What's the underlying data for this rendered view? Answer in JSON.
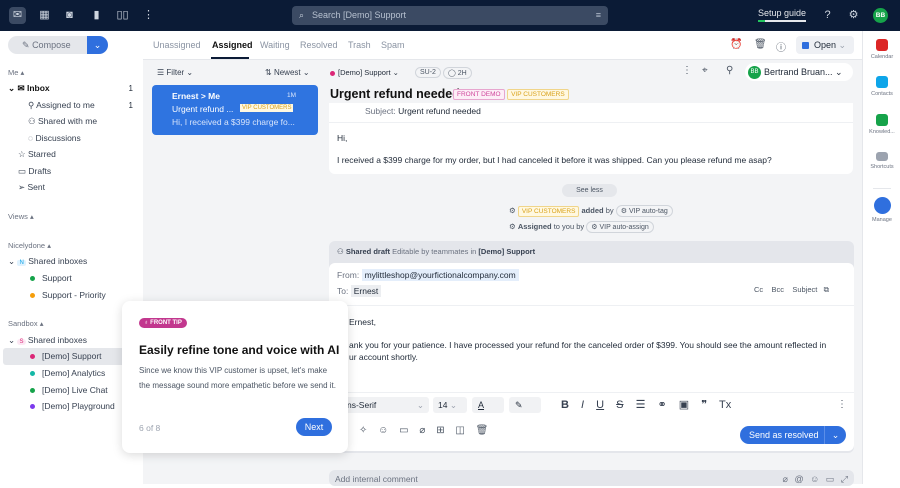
{
  "topbar": {
    "search_placeholder": "Search [Demo] Support",
    "setup_guide": "Setup guide",
    "avatar": "BB",
    "setup_progress": 0.15
  },
  "sidebar": {
    "compose": "Compose",
    "me": "Me",
    "inbox": "Inbox",
    "inbox_count": "1",
    "assigned_to_me": "Assigned to me",
    "assigned_count": "1",
    "shared_with_me": "Shared with me",
    "discussions": "Discussions",
    "starred": "Starred",
    "drafts": "Drafts",
    "sent": "Sent",
    "views": "Views",
    "nicelydone": "Nicelydone",
    "shared_inboxes_n": "Shared inboxes",
    "n_badge": "N",
    "support": "Support",
    "support_priority": "Support - Priority",
    "sandbox": "Sandbox",
    "shared_inboxes_s": "Shared inboxes",
    "s_badge": "S",
    "demo_support": "[Demo] Support",
    "demo_analytics": "[Demo] Analytics",
    "demo_live_chat": "[Demo] Live Chat",
    "demo_playground": "[Demo] Playground"
  },
  "tabs": [
    "Unassigned",
    "Assigned",
    "Waiting",
    "Resolved",
    "Trash",
    "Spam"
  ],
  "toolbar": {
    "status": "Open",
    "filter": "Filter",
    "sort": "Newest",
    "inbox": "[Demo] Support",
    "id": "SU-2",
    "time": "2H",
    "assignee": "Bertrand Bruan...",
    "assignee_avatar": "BB"
  },
  "list": [
    {
      "from": "Ernest > Me",
      "time": "1M",
      "subject": "Urgent refund ...",
      "tag": "VIP CUSTOMERS",
      "preview": "Hi, I received a $399 charge fo..."
    }
  ],
  "conversation": {
    "title": "Urgent refund needed",
    "tags": [
      "FRONT DEMO",
      "VIP CUSTOMERS"
    ],
    "subject_label": "Subject:",
    "subject": "Urgent refund needed",
    "greeting": "Hi,",
    "body": "I received a $399 charge for my order, but I had canceled it before it was shipped. Can you please refund me asap?",
    "see_less": "See less",
    "activity1": {
      "tag": "VIP CUSTOMERS",
      "added": "added",
      "by": "by",
      "rule": "VIP auto-tag"
    },
    "activity2": {
      "assigned": "Assigned",
      "to_you_by": "to you by",
      "rule": "VIP auto-assign"
    }
  },
  "draft": {
    "header": "Shared draft",
    "editable": "Editable by teammates in",
    "inbox": "[Demo] Support",
    "from_label": "From:",
    "from": "mylittleshop@yourfictionalcompany.com",
    "to_label": "To:",
    "to": "Ernest",
    "cc": "Cc",
    "bcc": "Bcc",
    "subject": "Subject",
    "greeting": "Ernest,",
    "body": "ank you for your patience. I have processed your refund for the canceled order of $399. You should see the amount reflected in",
    "body2": "ur account shortly.",
    "font": "ns-Serif",
    "size": "14",
    "send": "Send as resolved",
    "comment_placeholder": "Add internal comment"
  },
  "tip": {
    "badge": "FRONT TIP",
    "title": "Easily refine tone and voice with AI",
    "body": "Since we know this VIP customer is upset, let's make the message sound more empathetic before we send it.",
    "progress": "6 of 8",
    "next": "Next"
  },
  "rail": [
    "Calendar",
    "Contacts",
    "Knowled...",
    "Shortcuts",
    "Manage"
  ]
}
